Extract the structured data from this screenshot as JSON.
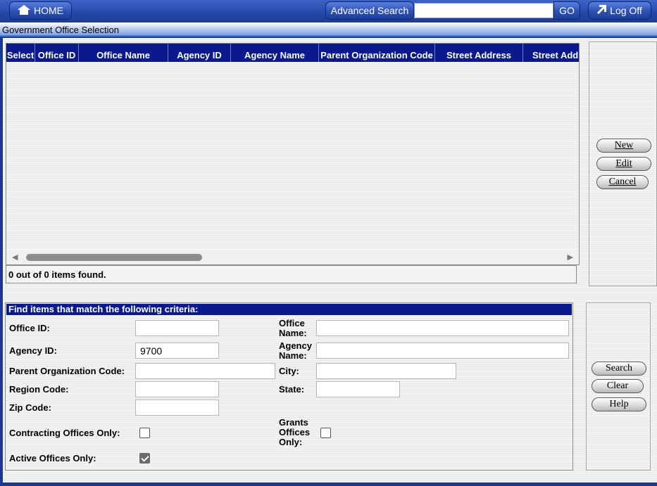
{
  "topbar": {
    "home_label": "HOME",
    "advanced_search_label": "Advanced Search",
    "search_value": "",
    "go_label": "GO",
    "logoff_label": "Log Off"
  },
  "page_title": "Government Office Selection",
  "grid": {
    "columns": [
      "Select",
      "Office ID",
      "Office Name",
      "Agency ID",
      "Agency Name",
      "Parent Organization Code",
      "Street Address",
      "Street Add"
    ],
    "rows": [],
    "status_text": "0 out of 0 items found."
  },
  "grid_actions": {
    "new_label": "New",
    "edit_label": "Edit",
    "cancel_label": "Cancel"
  },
  "criteria": {
    "heading": "Find items that match the following criteria:",
    "office_id": {
      "label": "Office ID:",
      "value": ""
    },
    "office_name": {
      "label_1": "Office",
      "label_2": "Name:",
      "value": ""
    },
    "agency_id": {
      "label": "Agency ID:",
      "value": "9700"
    },
    "agency_name": {
      "label_1": "Agency",
      "label_2": "Name:",
      "value": ""
    },
    "parent_org_code": {
      "label": "Parent Organization Code:",
      "value": ""
    },
    "city": {
      "label": "City:",
      "value": ""
    },
    "region_code": {
      "label": "Region Code:",
      "value": ""
    },
    "state": {
      "label": "State:",
      "value": ""
    },
    "zip_code": {
      "label": "Zip Code:",
      "value": ""
    },
    "contracting_only": {
      "label": "Contracting Offices Only:",
      "checked": false
    },
    "grants_only": {
      "label_1": "Grants",
      "label_2": "Offices",
      "label_3": "Only:",
      "checked": false
    },
    "active_only": {
      "label": "Active Offices Only:",
      "checked": true
    }
  },
  "criteria_actions": {
    "search_label": "Search",
    "clear_label": "Clear",
    "help_label": "Help"
  }
}
